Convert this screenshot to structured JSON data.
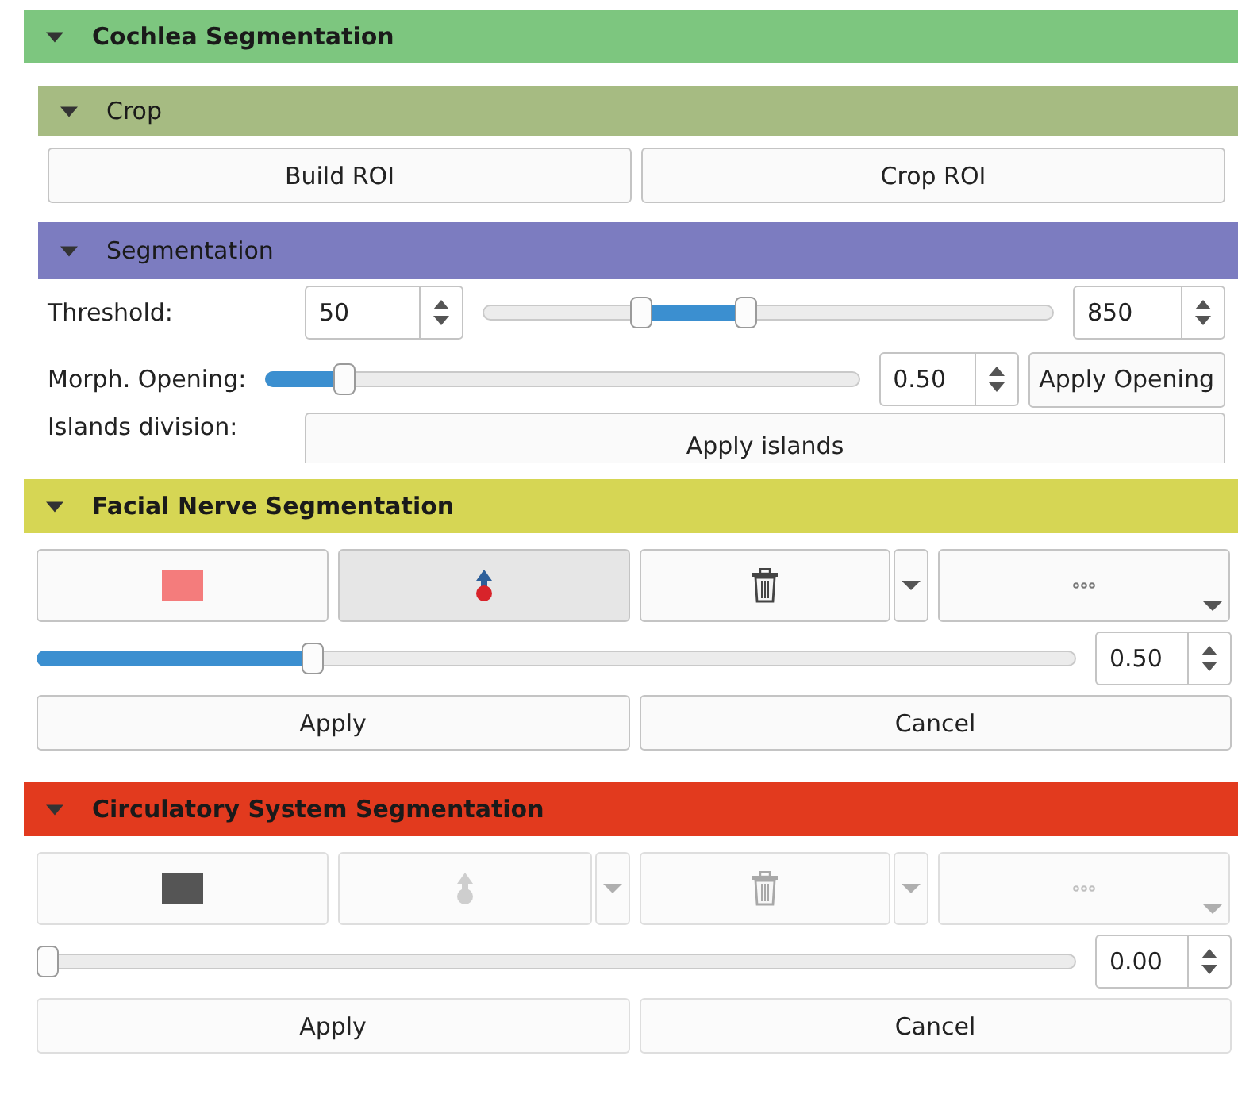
{
  "sections": [
    {
      "kind": "cochlea",
      "title": "Cochlea Segmentation",
      "color": "#7dc67f",
      "expanded": true,
      "crop": {
        "title": "Crop",
        "color": "#a6bb82",
        "expanded": true,
        "buttons": [
          "Build ROI",
          "Crop ROI"
        ]
      },
      "segmentation": {
        "title": "Segmentation",
        "color": "#7c7cc0",
        "expanded": true,
        "threshold": {
          "label": "Threshold:",
          "min": "50",
          "max": "850",
          "thumbs": [
            {
              "level": 0.27
            },
            {
              "level": 0.46
            }
          ]
        },
        "opening": {
          "label": "Morph. Opening:",
          "level": 0.12,
          "value": "0.50",
          "button": "Apply Opening"
        },
        "islands": {
          "label": "Islands division:",
          "button": "Apply islands"
        }
      }
    },
    {
      "kind": "editor",
      "title": "Facial Nerve Segmentation",
      "color": "#d6d654",
      "expanded": true,
      "disabled": false,
      "tools": [
        {
          "kind": "swatch",
          "color": "#f47c7c",
          "selected": false,
          "dropdown": false
        },
        {
          "kind": "place",
          "selected": true,
          "dropdown": false
        },
        {
          "kind": "delete",
          "selected": false,
          "dropdown": true
        },
        {
          "kind": "more",
          "selected": false,
          "dropdown": false
        }
      ],
      "slider": {
        "level": 0.26,
        "value": "0.50"
      },
      "buttons": [
        "Apply",
        "Cancel"
      ]
    },
    {
      "kind": "editor",
      "title": "Circulatory System Segmentation",
      "color": "#e23a1e",
      "expanded": true,
      "disabled": true,
      "tools": [
        {
          "kind": "swatch",
          "color": "#555555",
          "selected": false,
          "dropdown": false
        },
        {
          "kind": "place",
          "selected": false,
          "dropdown": true
        },
        {
          "kind": "delete",
          "selected": false,
          "dropdown": true
        },
        {
          "kind": "more",
          "selected": false,
          "dropdown": false
        }
      ],
      "slider": {
        "level": 0,
        "value": "0.00"
      },
      "buttons": [
        "Apply",
        "Cancel"
      ]
    }
  ]
}
